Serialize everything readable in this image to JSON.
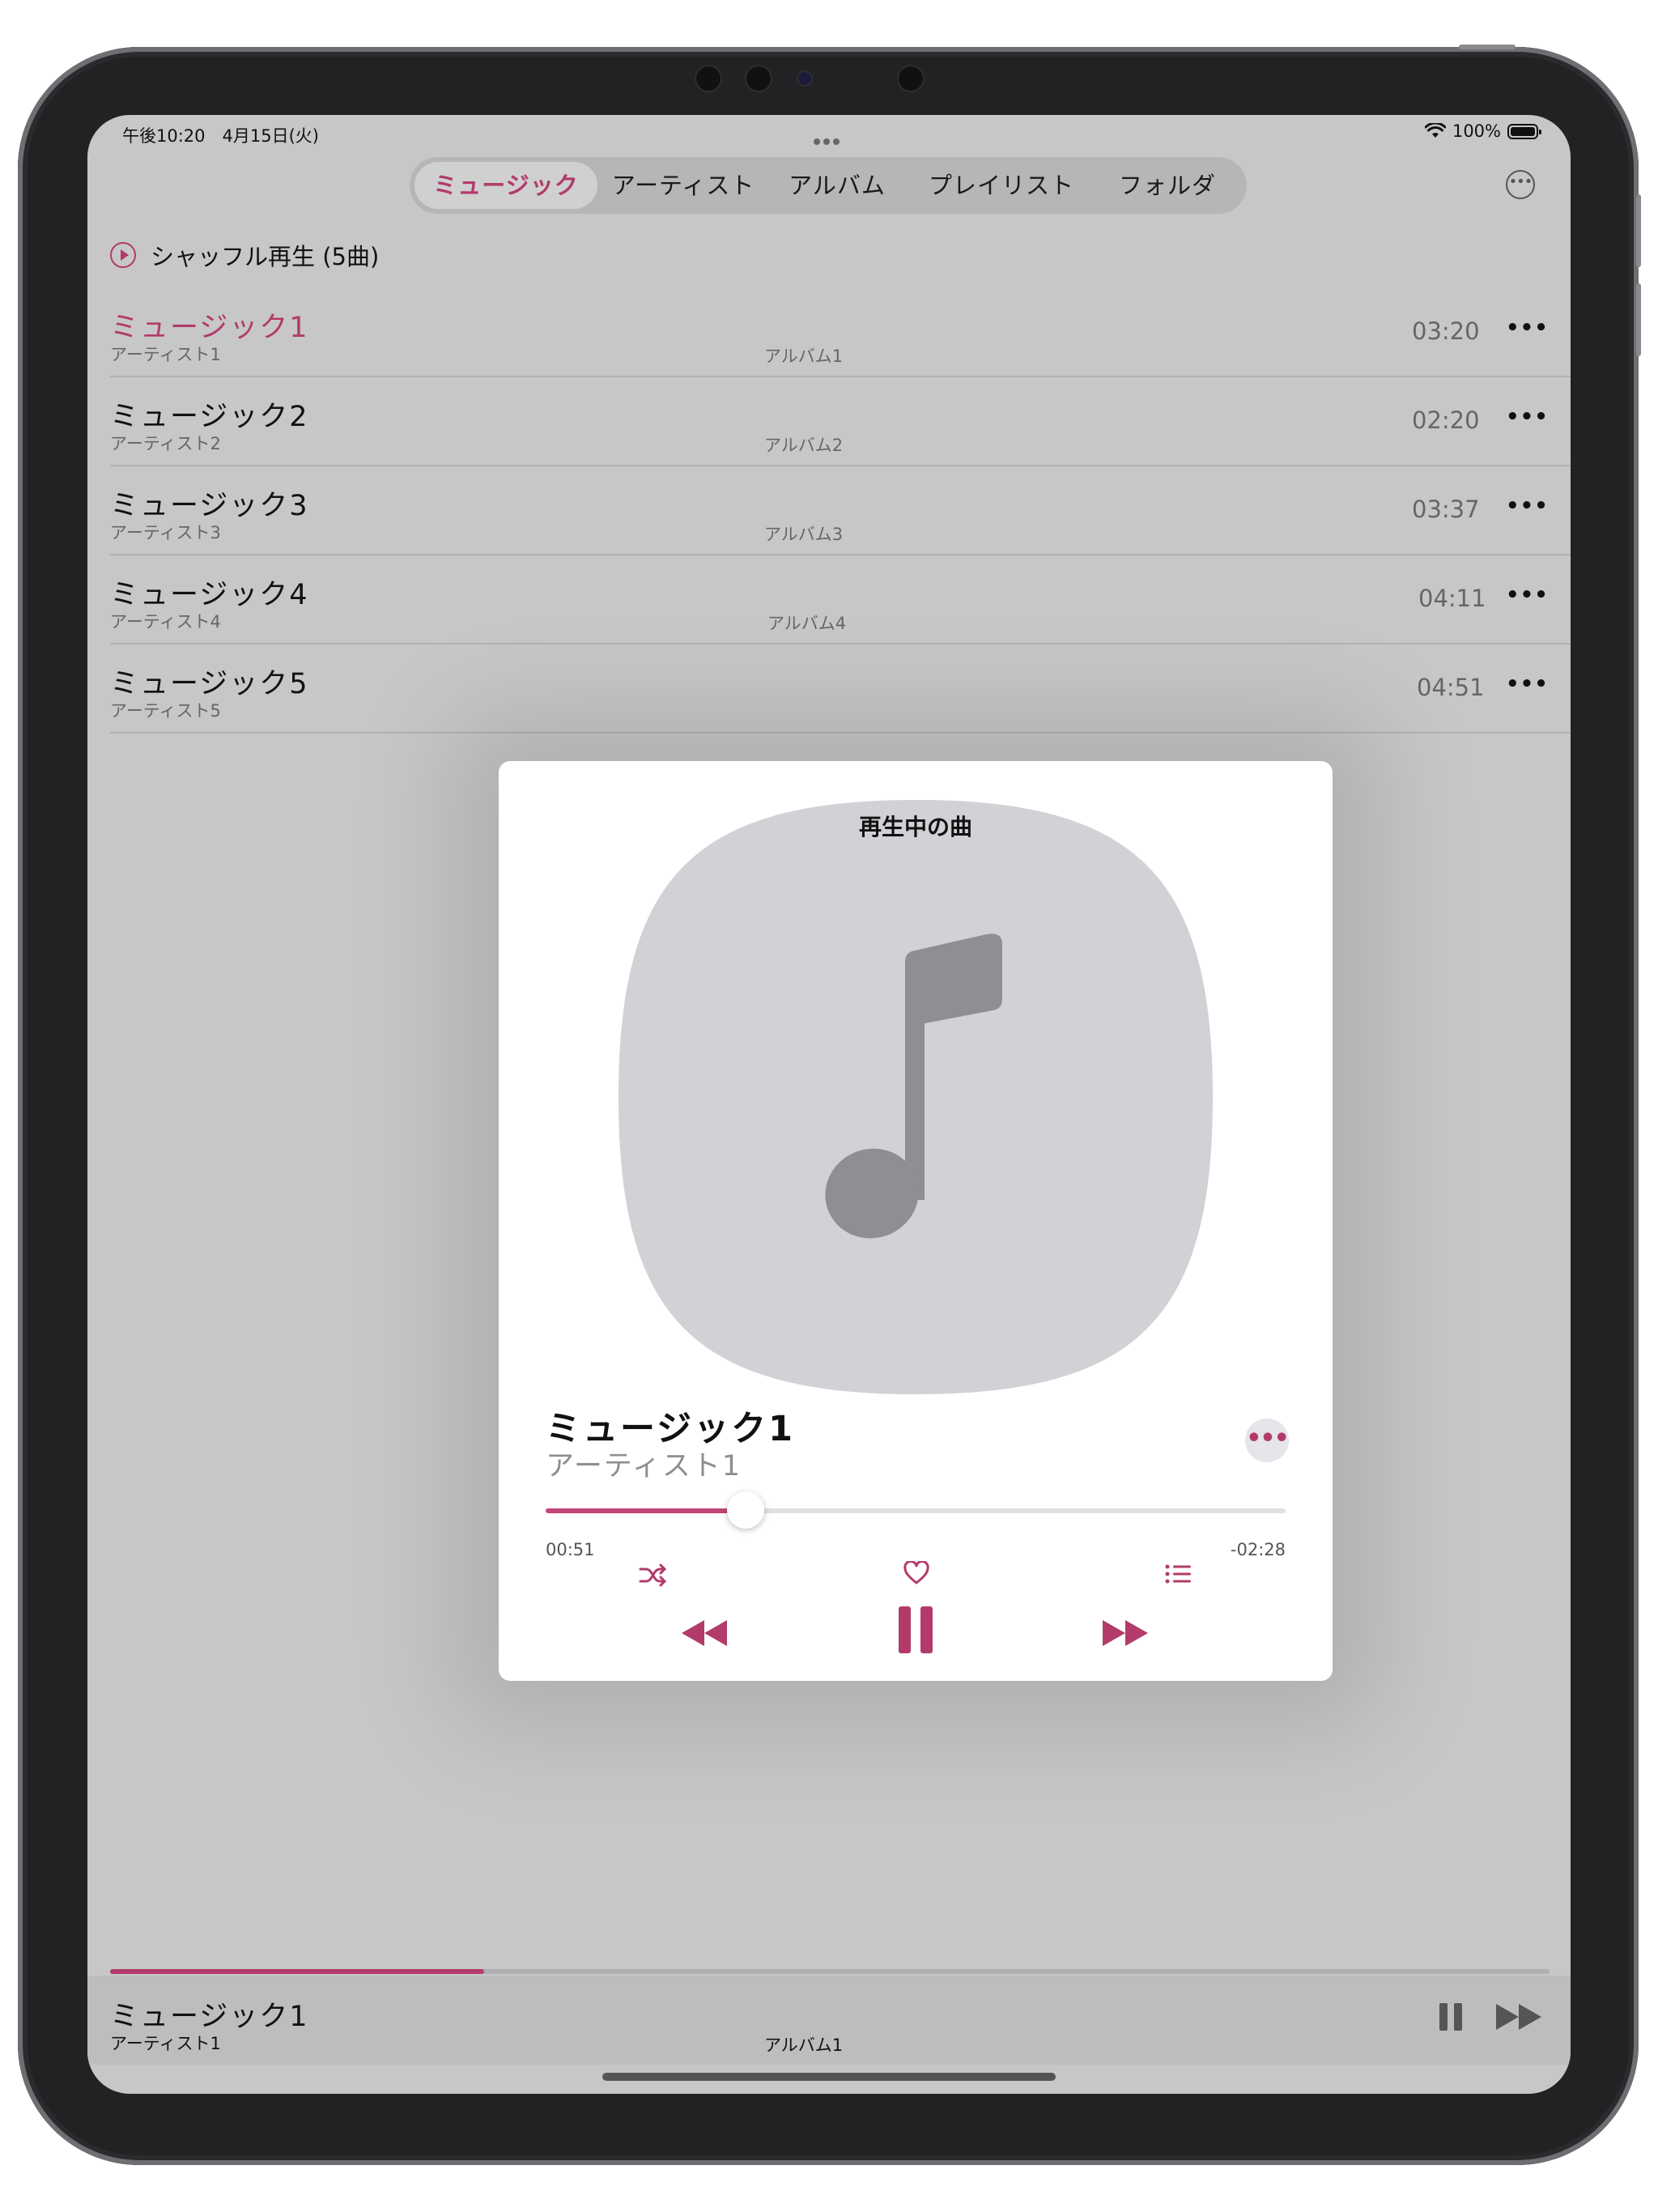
{
  "status_bar": {
    "time": "午後10:20　4月15日(火)",
    "battery": "100%"
  },
  "tabs": [
    {
      "label": "ミュージック",
      "active": true
    },
    {
      "label": "アーティスト",
      "active": false
    },
    {
      "label": "アルバム",
      "active": false
    },
    {
      "label": "プレイリスト",
      "active": false
    },
    {
      "label": "フォルダ",
      "active": false
    }
  ],
  "shuffle": {
    "label": "シャッフル再生 (5曲)"
  },
  "tracks": [
    {
      "title": "ミュージック1",
      "artist": "アーティスト1",
      "album": "アルバム1",
      "duration": "03:20",
      "current": true
    },
    {
      "title": "ミュージック2",
      "artist": "アーティスト2",
      "album": "アルバム2",
      "duration": "02:20",
      "current": false
    },
    {
      "title": "ミュージック3",
      "artist": "アーティスト3",
      "album": "アルバム3",
      "duration": "03:37",
      "current": false
    },
    {
      "title": "ミュージック4",
      "artist": "アーティスト4",
      "album": "アルバム4",
      "duration": "04:11",
      "current": false
    },
    {
      "title": "ミュージック5",
      "artist": "アーティスト5",
      "album": "",
      "duration": "04:51",
      "current": false
    }
  ],
  "now_playing": {
    "header": "再生中の曲",
    "title": "ミュージック1",
    "artist": "アーティスト1",
    "elapsed": "00:51",
    "remaining": "-02:28",
    "progress": 0.27,
    "icons": [
      "shuffle-icon",
      "heart-icon",
      "queue-list-icon",
      "rewind-icon",
      "pause-icon",
      "fast-forward-icon"
    ]
  },
  "mini_player": {
    "title": "ミュージック1",
    "artist": "アーティスト1",
    "album": "アルバム1",
    "progress": 0.26
  },
  "colors": {
    "accent": "#b23b6b",
    "background": "#c7c7c7",
    "card": "#ffffff"
  }
}
